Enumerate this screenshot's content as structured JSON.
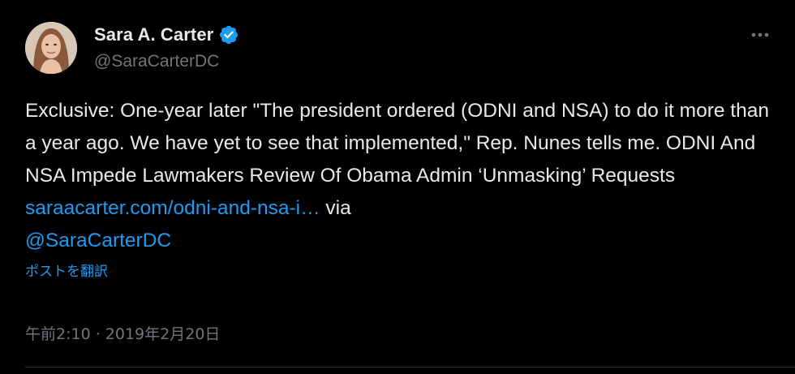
{
  "author": {
    "name": "Sara A. Carter",
    "handle": "@SaraCarterDC",
    "verified_icon": "verified-badge-icon"
  },
  "tweet": {
    "text_before_link": "Exclusive: One-year later \"The president ordered (ODNI and NSA) to do it more than a year ago. We have yet to see that implemented,\" Rep. Nunes tells me. ODNI And NSA Impede Lawmakers Review Of Obama Admin ‘Unmasking’ Requests ",
    "link_text": "saraacarter.com/odni-and-nsa-i…",
    "text_middle": " via",
    "mention": "@SaraCarterDC",
    "translate_label": "ポストを翻訳",
    "timestamp": "午前2:10 · 2019年2月20日"
  },
  "colors": {
    "background": "#000000",
    "text": "#e7e9ea",
    "secondary": "#71767b",
    "accent": "#1d9bf0"
  }
}
